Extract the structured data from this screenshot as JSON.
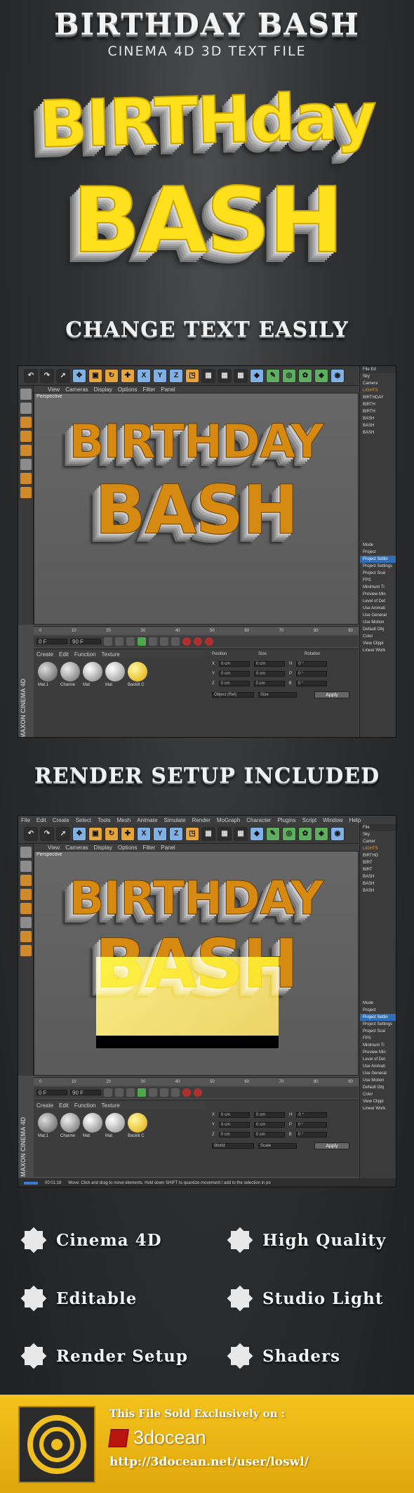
{
  "header": {
    "title": "BIRTHDAY BASH",
    "subtitle": "CINEMA 4D 3D TEXT FILE"
  },
  "hero": {
    "line1": "BIRTHday",
    "line2": "BASH",
    "color": "#ffe01c"
  },
  "sections": {
    "change_text": "CHANGE TEXT EASILY",
    "render_setup": "RENDER SETUP INCLUDED"
  },
  "c4d": {
    "menu": [
      "File",
      "Edit",
      "Create",
      "Select",
      "Tools",
      "Mesh",
      "Animate",
      "Simulate",
      "Render",
      "MoGraph",
      "Character",
      "Plugins",
      "Script",
      "Window",
      "Help"
    ],
    "view_menu": [
      "View",
      "Cameras",
      "Display",
      "Options",
      "Filter",
      "Panel"
    ],
    "viewport_label": "Perspective",
    "viewport_text_1": "BIRTHDAY",
    "viewport_text_2": "BASH",
    "objects": [
      "Sky",
      "Camera",
      "LIGHTS",
      "BIRTHDAY",
      "BIRTH",
      "BIRTH",
      "BASH",
      "BASH",
      "BASH"
    ],
    "objects_short": [
      "Sky",
      "Camer",
      "LIGHTS",
      "BIRTHD",
      "BIRT",
      "BIRT",
      "BASH",
      "BASH",
      "BASH"
    ],
    "attr": {
      "mode": "Mode",
      "project": "Project",
      "project_settings": "Project Settin",
      "project_settings_2": "Project Settings",
      "project_scale": "Project Scal",
      "fps": "FPS",
      "minimum_time": "Minimum Ti",
      "preview_min": "Preview Min",
      "level_of_detail": "Level of Det",
      "use_animation": "Use Animati",
      "use_generators": "Use Generat",
      "use_motion": "Use Motion",
      "default_object": "Default Obj",
      "color": "Color",
      "view_clipping": "View Clippi",
      "linear_workflow": "Linear Work"
    },
    "timeline_ticks": [
      "0",
      "10",
      "20",
      "30",
      "40",
      "50",
      "60",
      "70",
      "80",
      "90"
    ],
    "frame_start": "0 F",
    "frame_end": "90 F",
    "materials_menu": [
      "Create",
      "Edit",
      "Function",
      "Texture"
    ],
    "materials": [
      "Mat.1",
      "Channe",
      "Mat",
      "Mat",
      "Backlit C"
    ],
    "coords": {
      "position": "Position",
      "size": "Size",
      "rotation": "Rotation",
      "x_label": "X",
      "y_label": "Y",
      "z_label": "Z",
      "h_label": "H",
      "p_label": "P",
      "b_label": "B",
      "zero_cm": "0 cm",
      "zero_deg": "0 °",
      "object_rel": "Object (Rel)",
      "world": "World",
      "size_drop": "Size",
      "scale_drop": "Scale",
      "apply": "Apply"
    },
    "maxon": "MAXON CINEMA 4D",
    "status_time": "00:01:18",
    "status_text": "Move: Click and drag to move elements. Hold down SHIFT to quantize movement / add to the selection in po"
  },
  "features": [
    {
      "label": "Cinema 4D"
    },
    {
      "label": "High Quality"
    },
    {
      "label": "Editable"
    },
    {
      "label": "Studio Light"
    },
    {
      "label": "Render Setup"
    },
    {
      "label": "Shaders"
    }
  ],
  "footer": {
    "sold_text": "This File Sold Exclusively on :",
    "marketplace": "3docean",
    "url": "http://3docean.net/user/loswl/",
    "bg_color": "#f3c21c"
  }
}
